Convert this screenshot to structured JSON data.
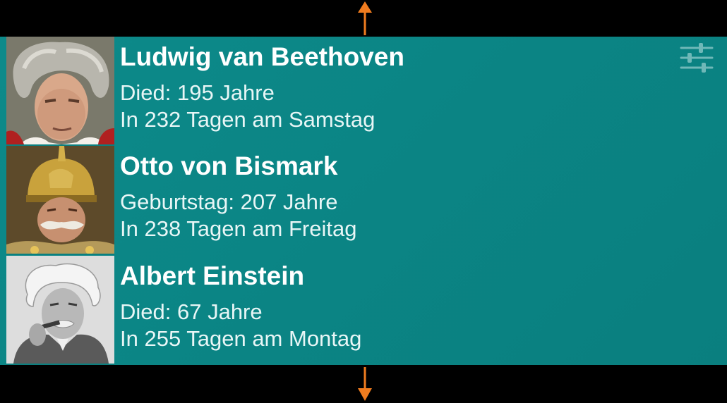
{
  "widget": {
    "settings_icon": "sliders-icon",
    "accent_color": "#0b8585",
    "people": [
      {
        "name": "Ludwig van Beethoven",
        "line1": "Died: 195 Jahre",
        "line2": "In 232 Tagen am Samstag"
      },
      {
        "name": "Otto von Bismark",
        "line1": "Geburtstag: 207 Jahre",
        "line2": "In 238 Tagen am Freitag"
      },
      {
        "name": "Albert Einstein",
        "line1": "Died: 67 Jahre",
        "line2": "In 255 Tagen am Montag"
      }
    ]
  },
  "resize_handles": {
    "color": "#f07c1f",
    "icon_top": "arrow-up-icon",
    "icon_bottom": "arrow-down-icon"
  }
}
